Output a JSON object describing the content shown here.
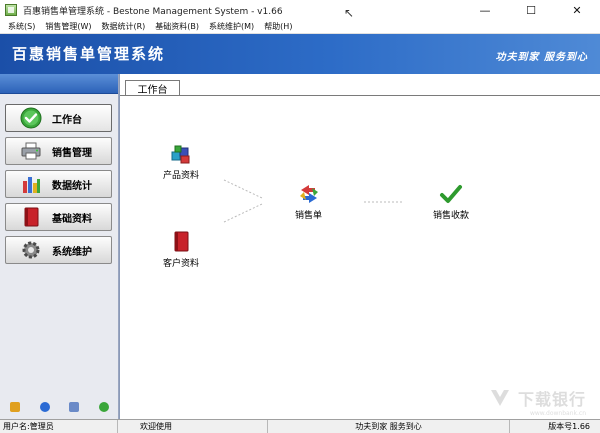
{
  "window": {
    "title": "百惠销售单管理系统 - Bestone Management System - v1.66",
    "minimize": "—",
    "maximize": "☐",
    "close": "✕"
  },
  "menu": [
    "系统(S)",
    "销售管理(W)",
    "数据统计(R)",
    "基础资料(B)",
    "系统维护(M)",
    "帮助(H)"
  ],
  "banner": {
    "title": "百惠销售单管理系统",
    "slogan": "功夫到家 服务到心"
  },
  "sidebar": {
    "items": [
      {
        "label": "工作台",
        "icon": "check-icon",
        "active": true
      },
      {
        "label": "销售管理",
        "icon": "printer-icon",
        "active": false
      },
      {
        "label": "数据统计",
        "icon": "bar-chart-icon",
        "active": false
      },
      {
        "label": "基础资料",
        "icon": "book-icon",
        "active": false
      },
      {
        "label": "系统维护",
        "icon": "gear-icon",
        "active": false
      }
    ],
    "bottom_icons": [
      "edit-icon",
      "info-icon",
      "view-icon",
      "exit-icon"
    ]
  },
  "main": {
    "tab_label": "工作台",
    "flow": {
      "product": "产品资料",
      "customer": "客户资料",
      "order": "销售单",
      "receipt": "销售收款"
    }
  },
  "status": {
    "user": "用户名:管理员",
    "welcome": "欢迎使用",
    "slogan": "功夫到家 服务到心",
    "version": "版本号1.66"
  },
  "watermark": {
    "text": "下载银行",
    "sub": "www.downbank.cn"
  },
  "colors": {
    "banner": "#2d6cc7",
    "sidebar_header": "#2c62b8",
    "check_green": "#2e9a2e"
  }
}
